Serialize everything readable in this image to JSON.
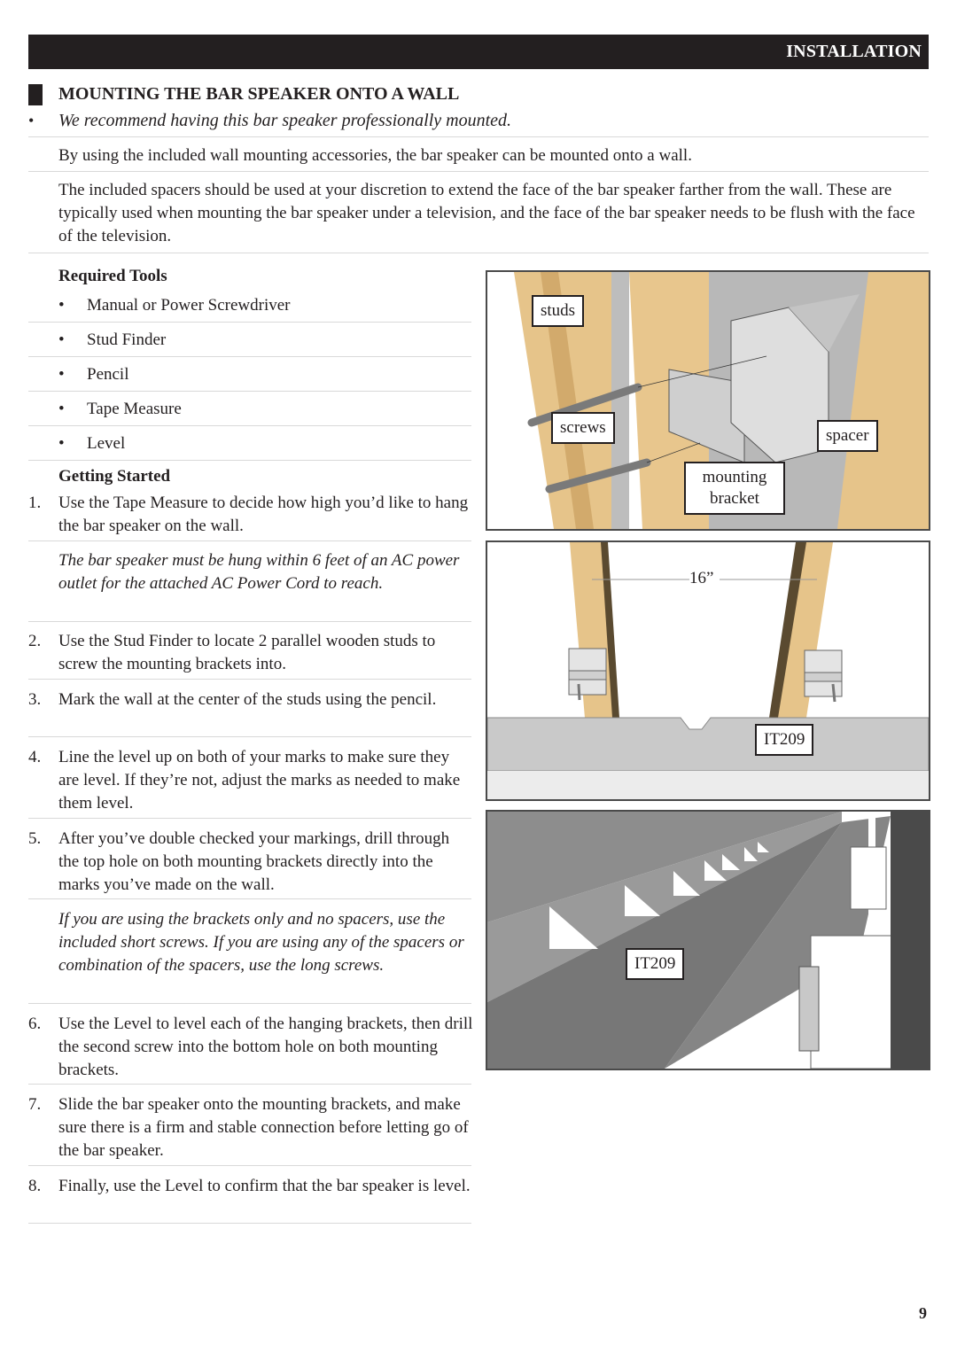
{
  "header": {
    "section": "INSTALLATION"
  },
  "section": {
    "title": "MOUNTING THE BAR SPEAKER ONTO A WALL",
    "recommendation": "We recommend having this bar speaker professionally mounted.",
    "intro": "By using the included wall mounting accessories, the bar speaker can be mounted onto a wall.",
    "spacers_paragraph": "The included spacers should be used at your discretion to extend the face of the bar speaker farther from the wall. These are typically used when mounting the bar speaker under a television, and the face of the bar speaker needs to be flush with the face of the television."
  },
  "required_tools": {
    "heading": "Required Tools",
    "items": [
      "Manual or Power Screwdriver",
      "Stud Finder",
      "Pencil",
      "Tape Measure",
      "Level"
    ]
  },
  "getting_started": {
    "heading": "Getting Started",
    "steps": [
      {
        "num": "1.",
        "text": "Use the Tape Measure to decide how high you’d like to hang the bar speaker on the wall."
      },
      {
        "num": "2.",
        "text": "Use the Stud Finder to locate 2 parallel wooden studs to screw the mounting brackets into."
      },
      {
        "num": "3.",
        "text": "Mark the wall at the center of the studs using the pencil."
      },
      {
        "num": "4.",
        "text": "Line the level up on both of your marks to make sure they are level. If they’re not, adjust the marks as needed to make them level."
      },
      {
        "num": "5.",
        "text": "After you’ve double checked your markings, drill through the top hole on both mounting brackets directly into the marks you’ve made on the wall."
      },
      {
        "num": "6.",
        "text": "Use the Level to level each of the hanging brackets, then drill the second screw into the bottom hole on both mounting brackets."
      },
      {
        "num": "7.",
        "text": "Slide the bar speaker onto the mounting brackets, and make sure there is a firm and stable connection before letting go of the bar speaker."
      },
      {
        "num": "8.",
        "text": "Finally, use the Level to confirm that the bar speaker is level."
      }
    ],
    "notes": {
      "power": "The bar speaker must be hung within 6 feet of an AC power outlet for the attached AC Power Cord to reach.",
      "screws": "If you are using the brackets only and no spacers, use the included short screws. If you are using any of the spacers or combination of the spacers, use the long screws."
    }
  },
  "figures": {
    "fig1": {
      "studs": "studs",
      "screws": "screws",
      "spacer": "spacer",
      "bracket_line1": "mounting",
      "bracket_line2": "bracket"
    },
    "fig2": {
      "distance": "16”",
      "model": "IT209"
    },
    "fig3": {
      "model": "IT209"
    }
  },
  "page_number": "9"
}
